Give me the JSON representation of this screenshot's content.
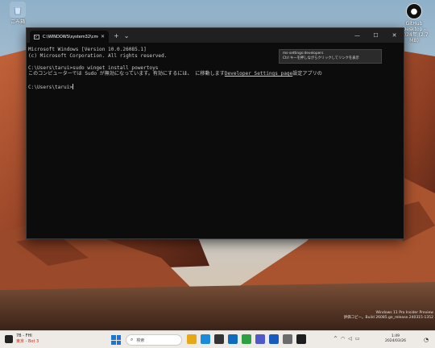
{
  "desktop": {
    "icons": [
      {
        "label": "ごみ箱"
      },
      {
        "label": "GitHub Desktop - 2024年 (2.7 MB)"
      }
    ],
    "watermark": {
      "line1": "Windows 11 Pro Insider Preview",
      "line2": "評価コピー。Build 26085.ge_release.240315-1352"
    }
  },
  "terminal": {
    "tab_title": "C:\\WINDOWS\\system32\\cmd",
    "new_tab": "+",
    "dropdown": "⌄",
    "controls": {
      "minimize": "—",
      "maximize": "☐",
      "close": "✕"
    },
    "lines": [
      "Microsoft Windows [Version 10.0.26085.1]",
      "(c) Microsoft Corporation. All rights reserved.",
      "",
      "C:\\Users\\tarui>sudo winget install powertoys"
    ],
    "message_prefix": "このコンピューターでは Sudo が無効になっています。有効にするには、 に移動します",
    "message_link": "Developer Settings page",
    "message_suffix": "設定アプリの",
    "prompt": "C:\\Users\\tarui>",
    "tooltip": {
      "line1": "ms-settings:developers",
      "line2": "Ctrl キーを押しながらクリックしてリンクを表示"
    }
  },
  "taskbar": {
    "weather_temp": "7B - FHI",
    "weather_alert": "東京 - Bot 3",
    "search_placeholder": "検索",
    "apps": [
      {
        "icon": "file-explorer-icon",
        "color": "#e6a817"
      },
      {
        "icon": "edge-icon",
        "color": "#1c8ad6"
      },
      {
        "icon": "store-icon",
        "color": "#333333"
      },
      {
        "icon": "mail-icon",
        "color": "#0f6cbd"
      },
      {
        "icon": "chrome-icon",
        "color": "#2ea043"
      },
      {
        "icon": "teams-icon",
        "color": "#5059c9"
      },
      {
        "icon": "word-icon",
        "color": "#185abd"
      },
      {
        "icon": "settings-icon",
        "color": "#6b6b6b"
      },
      {
        "icon": "terminal-icon",
        "color": "#1e1e1e"
      }
    ],
    "time": "1:49",
    "date": "2024/03/26"
  }
}
